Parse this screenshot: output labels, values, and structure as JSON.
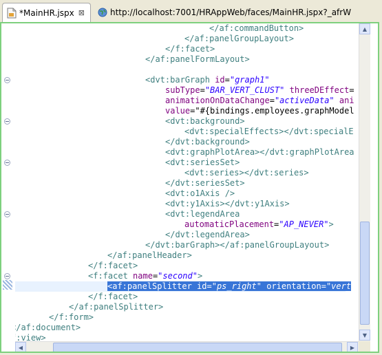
{
  "tabs": [
    {
      "label": "*MainHR.jspx",
      "icon": "jspx-file-icon",
      "active": true,
      "close": "⊠"
    },
    {
      "label": "http://localhost:7001/HRAppWeb/faces/MainHR.jspx?_afrW",
      "icon": "globe-icon",
      "active": false
    }
  ],
  "code": {
    "l1": "</af:commandButton>",
    "l2": "</af:panelGroupLayout>",
    "l3": "</f:facet>",
    "l4": "</af:panelFormLayout>",
    "l6a": "<dvt:barGraph ",
    "l6b": "id",
    "l6c": "\"graph1\"",
    "l7a": "subType",
    "l7b": "\"BAR_VERT_CLUST\"",
    "l7c": "threeDEffect",
    "l8a": "animationOnDataChange",
    "l8b": "\"activeData\"",
    "l8c": "ani",
    "l9a": "value",
    "l9b": "\"#{bindings.employees.graphModel",
    "l10": "<dvt:background>",
    "l11": "<dvt:specialEffects></dvt:specialE",
    "l12": "</dvt:background>",
    "l13": "<dvt:graphPlotArea></dvt:graphPlotArea",
    "l14": "<dvt:seriesSet>",
    "l15": "<dvt:series></dvt:series>",
    "l16": "</dvt:seriesSet>",
    "l17": "<dvt:o1Axis />",
    "l18": "<dvt:y1Axis></dvt:y1Axis>",
    "l19": "<dvt:legendArea",
    "l20a": "automaticPlacement",
    "l20b": "\"AP_NEVER\"",
    "l20c": ">",
    "l21": "</dvt:legendArea>",
    "l22": "</dvt:barGraph></af:panelGroupLayout>",
    "l23": "</af:panelHeader>",
    "l24": "</f:facet>",
    "l25a": "<f:facet ",
    "l25b": "name",
    "l25c": "\"second\"",
    "l25d": ">",
    "l26a": "<af:panelSplitter ",
    "l26b": "id",
    "l26c": "\"ps_right\"",
    "l26d": "orientation",
    "l26e": "\"vert",
    "l27": "</f:facet>",
    "l28": "</af:panelSplitter>",
    "l29": "</f:form>",
    "l30": "</af:document>",
    "l31": "f:view>",
    "eq": "="
  },
  "colors": {
    "tag": "#3f7f7f",
    "attribute": "#7f007f",
    "string": "#2a00ff",
    "selection": "#3875d7",
    "editor_border": "#7ed07e"
  }
}
